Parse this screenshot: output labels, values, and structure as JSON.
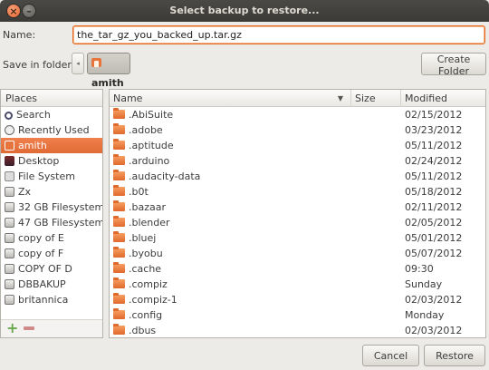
{
  "window": {
    "title": "Select backup to restore..."
  },
  "name_field": {
    "label": "Name:",
    "value": "the_tar_gz_you_backed_up.tar.gz"
  },
  "location": {
    "label": "Save in folder:",
    "current_folder": "amith",
    "create_folder_label": "Create Folder"
  },
  "places": {
    "header": "Places",
    "items": [
      {
        "label": "Search",
        "icon": "search-icon"
      },
      {
        "label": "Recently Used",
        "icon": "recent-icon"
      },
      {
        "label": "amith",
        "icon": "home-folder-icon",
        "selected": true
      },
      {
        "label": "Desktop",
        "icon": "desktop-icon"
      },
      {
        "label": "File System",
        "icon": "filesystem-icon"
      },
      {
        "label": "Zx",
        "icon": "drive-icon"
      },
      {
        "label": "32 GB Filesystem",
        "icon": "drive-icon"
      },
      {
        "label": "47 GB Filesystem",
        "icon": "drive-icon"
      },
      {
        "label": "copy of E",
        "icon": "drive-icon"
      },
      {
        "label": "copy of F",
        "icon": "drive-icon"
      },
      {
        "label": "COPY OF D",
        "icon": "drive-icon"
      },
      {
        "label": "DBBAKUP",
        "icon": "drive-icon"
      },
      {
        "label": "britannica",
        "icon": "drive-icon"
      }
    ]
  },
  "files": {
    "columns": {
      "name": "Name",
      "size": "Size",
      "modified": "Modified"
    },
    "rows": [
      {
        "name": ".AbiSuite",
        "modified": "02/15/2012"
      },
      {
        "name": ".adobe",
        "modified": "03/23/2012"
      },
      {
        "name": ".aptitude",
        "modified": "05/11/2012"
      },
      {
        "name": ".arduino",
        "modified": "02/24/2012"
      },
      {
        "name": ".audacity-data",
        "modified": "05/11/2012"
      },
      {
        "name": ".b0t",
        "modified": "05/18/2012"
      },
      {
        "name": ".bazaar",
        "modified": "02/11/2012"
      },
      {
        "name": ".blender",
        "modified": "02/05/2012"
      },
      {
        "name": ".bluej",
        "modified": "05/01/2012"
      },
      {
        "name": ".byobu",
        "modified": "05/07/2012"
      },
      {
        "name": ".cache",
        "modified": "09:30"
      },
      {
        "name": ".compiz",
        "modified": "Sunday"
      },
      {
        "name": ".compiz-1",
        "modified": "02/03/2012"
      },
      {
        "name": ".config",
        "modified": "Monday"
      },
      {
        "name": ".dbus",
        "modified": "02/03/2012"
      }
    ]
  },
  "buttons": {
    "cancel": "Cancel",
    "restore": "Restore"
  }
}
